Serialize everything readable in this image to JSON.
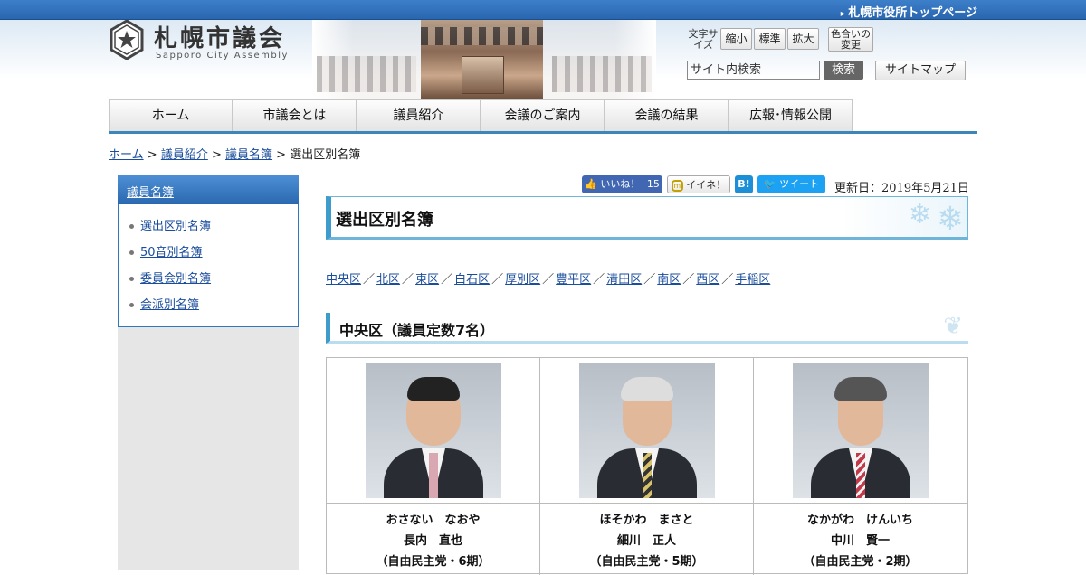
{
  "topbar": {
    "city_top_link": "札幌市役所トップページ"
  },
  "logo": {
    "name": "札幌市議会",
    "english": "Sapporo City Assembly"
  },
  "controls": {
    "text_size_label": "文字サイズ",
    "small": "縮小",
    "standard": "標準",
    "large": "拡大",
    "color_change": "色合いの変更",
    "search_value": "サイト内検索",
    "search_button": "検索",
    "sitemap": "サイトマップ"
  },
  "nav": [
    "ホーム",
    "市議会とは",
    "議員紹介",
    "会議のご案内",
    "会議の結果",
    "広報･情報公開"
  ],
  "breadcrumb": {
    "home": "ホーム",
    "members": "議員紹介",
    "roster": "議員名簿",
    "current": "選出区別名簿",
    "sep": ">"
  },
  "sidebar": {
    "heading": "議員名簿",
    "items": [
      "選出区別名簿",
      "50音別名簿",
      "委員会別名簿",
      "会派別名簿"
    ]
  },
  "share": {
    "like": "いいね！",
    "like_count": "15",
    "mixi": "イイネ！",
    "hatena": "B!",
    "tweet": "ツイート"
  },
  "updated": "更新日：2019年5月21日",
  "page_title": "選出区別名簿",
  "wards": [
    "中央区",
    "北区",
    "東区",
    "白石区",
    "厚別区",
    "豊平区",
    "清田区",
    "南区",
    "西区",
    "手稲区"
  ],
  "ward_sep": "／",
  "section_title": "中央区（議員定数7名）",
  "members": [
    {
      "kana": "おさない　なおや",
      "name": "長内　直也",
      "party": "（自由民主党・6期）"
    },
    {
      "kana": "ほそかわ　まさと",
      "name": "細川　正人",
      "party": "（自由民主党・5期）"
    },
    {
      "kana": "なかがわ　けんいち",
      "name": "中川　賢一",
      "party": "（自由民主党・2期）"
    }
  ],
  "colors": {
    "accent": "#2a68b0",
    "section_border": "#3d9ccc",
    "nav_underline": "#3d86b8"
  }
}
